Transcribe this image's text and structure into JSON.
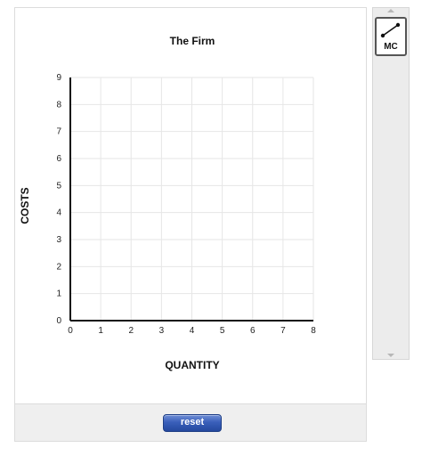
{
  "tool_panel": {
    "tools": [
      {
        "label": "MC",
        "icon": "line-segment-icon"
      }
    ],
    "scroll_up_icon": "triangle-up-icon",
    "scroll_down_icon": "triangle-down-icon"
  },
  "controls": {
    "reset_label": "reset"
  },
  "chart_data": {
    "type": "line",
    "title": "The Firm",
    "xlabel": "QUANTITY",
    "ylabel": "COSTS",
    "xlim": [
      0,
      8
    ],
    "ylim": [
      0,
      9
    ],
    "x_ticks": [
      "0",
      "1",
      "2",
      "3",
      "4",
      "5",
      "6",
      "7",
      "8"
    ],
    "y_ticks": [
      "0",
      "1",
      "2",
      "3",
      "4",
      "5",
      "6",
      "7",
      "8",
      "9"
    ],
    "grid": true,
    "series": []
  },
  "colors": {
    "axis": "#111111",
    "grid": "#e6e6e6",
    "button": "#3a5fba"
  }
}
